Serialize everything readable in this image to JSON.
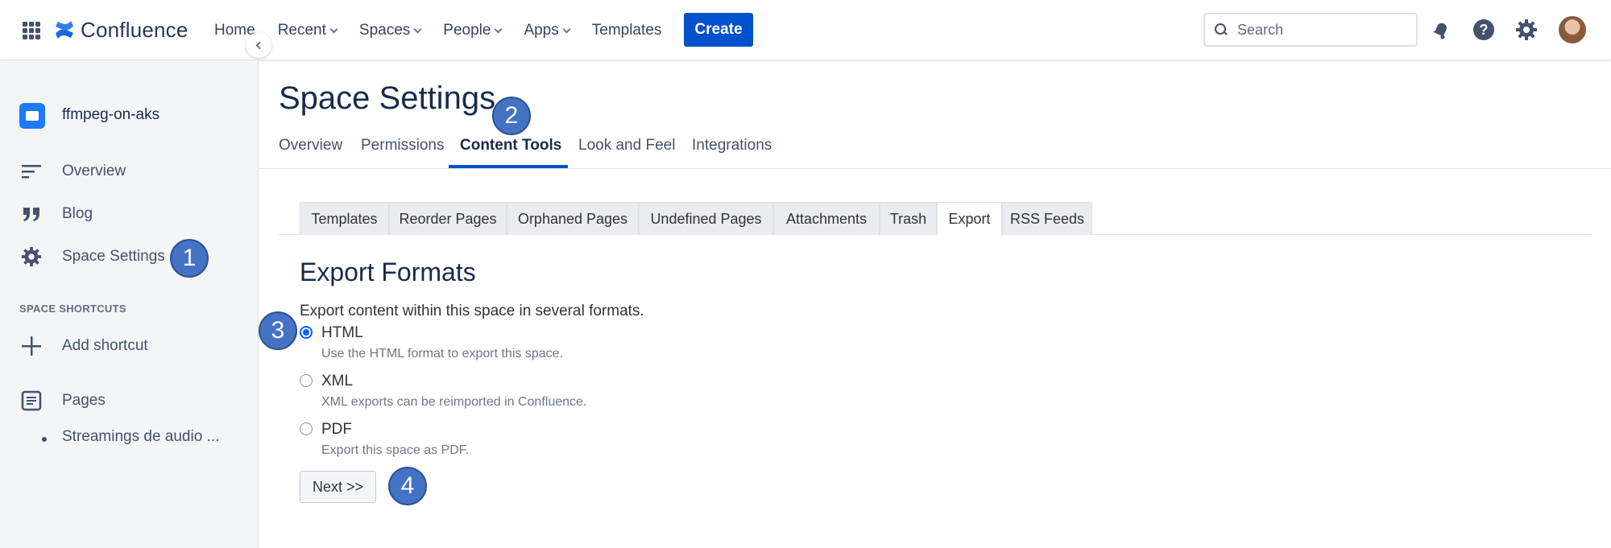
{
  "header": {
    "brand": "Confluence",
    "nav": [
      "Home",
      "Recent",
      "Spaces",
      "People",
      "Apps",
      "Templates"
    ],
    "create_label": "Create",
    "search_placeholder": "Search"
  },
  "sidebar": {
    "space_name": "ffmpeg-on-aks",
    "items": [
      {
        "label": "Overview",
        "icon": "overview-lines-icon"
      },
      {
        "label": "Blog",
        "icon": "quote-icon"
      },
      {
        "label": "Space Settings",
        "icon": "gear-icon"
      }
    ],
    "shortcuts_title": "SPACE SHORTCUTS",
    "add_shortcut": "Add shortcut",
    "pages_label": "Pages",
    "page_child": "Streamings de audio ..."
  },
  "main": {
    "title": "Space Settings",
    "tabs": [
      "Overview",
      "Permissions",
      "Content Tools",
      "Look and Feel",
      "Integrations"
    ],
    "active_tab": "Content Tools",
    "subtabs": [
      "Templates",
      "Reorder Pages",
      "Orphaned Pages",
      "Undefined Pages",
      "Attachments",
      "Trash",
      "Export",
      "RSS Feeds"
    ],
    "active_subtab": "Export",
    "heading": "Export Formats",
    "description": "Export content within this space in several formats.",
    "options": [
      {
        "label": "HTML",
        "help": "Use the HTML format to export this space.",
        "selected": true
      },
      {
        "label": "XML",
        "help": "XML exports can be reimported in Confluence.",
        "selected": false
      },
      {
        "label": "PDF",
        "help": "Export this space as PDF.",
        "selected": false
      }
    ],
    "next_label": "Next >>"
  },
  "callouts": [
    "1",
    "2",
    "3",
    "4"
  ],
  "colors": {
    "primary": "#0052cc",
    "callout": "#4472c4",
    "radio": "#0065ff"
  }
}
